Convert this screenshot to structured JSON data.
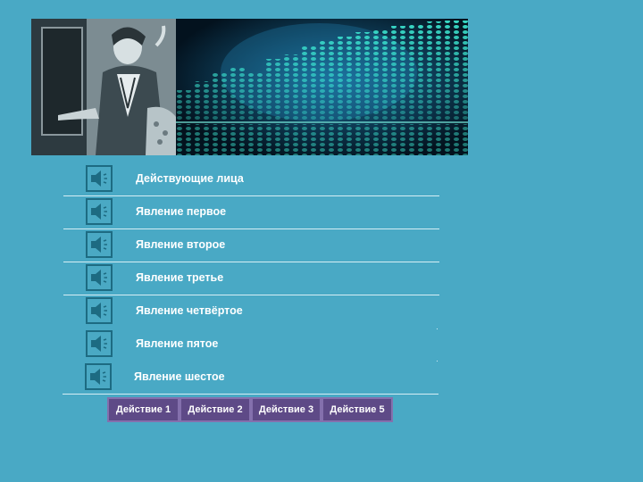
{
  "banner": {
    "photo_icon": "illustration-photo",
    "equalizer_icon": "equalizer-graphic"
  },
  "scenes": [
    {
      "label": "Действующие лица",
      "icon": "speaker-icon"
    },
    {
      "label": "Явление первое",
      "icon": "speaker-icon"
    },
    {
      "label": "Явление второе",
      "icon": "speaker-icon"
    },
    {
      "label": "Явление третье",
      "icon": "speaker-icon"
    },
    {
      "label": "Явление четвёртое",
      "icon": "speaker-icon"
    },
    {
      "label": "Явление пятое",
      "icon": "speaker-icon"
    },
    {
      "label": "Явление шестое",
      "icon": "speaker-icon"
    }
  ],
  "actions": [
    {
      "label": "Действие 1"
    },
    {
      "label": "Действие 2"
    },
    {
      "label": "Действие 3"
    },
    {
      "label": "Действие 5"
    }
  ],
  "colors": {
    "background": "#49a9c5",
    "button": "#5e4a87",
    "button_border": "#8470ad",
    "equalizer": "#3ff0d8"
  }
}
